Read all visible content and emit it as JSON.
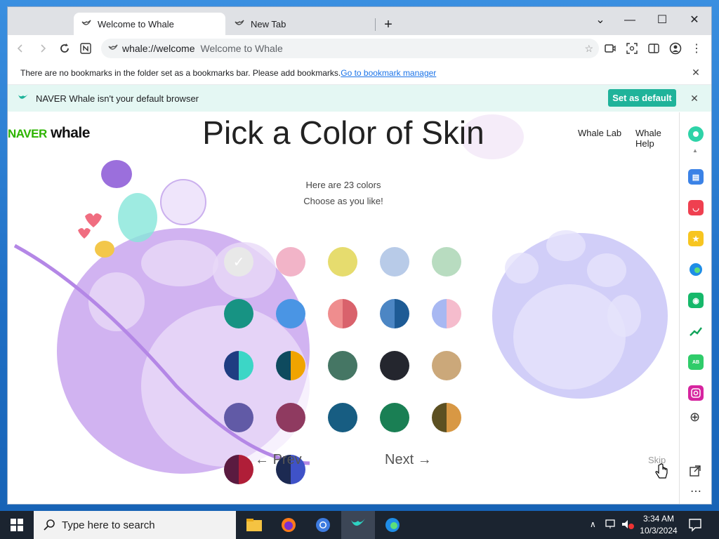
{
  "browser": {
    "tabs": [
      {
        "label": "Welcome to Whale",
        "active": true
      },
      {
        "label": "New Tab",
        "active": false
      }
    ],
    "window_controls": {
      "minimize": "—",
      "maximize": "☐",
      "close": "✕"
    },
    "address": {
      "url": "whale://welcome",
      "title": "Welcome to Whale"
    }
  },
  "bookmark_bar": {
    "message": "There are no bookmarks in the folder set as a bookmarks bar. Please add bookmarks.",
    "link": "Go to bookmark manager"
  },
  "default_bar": {
    "message": "NAVER Whale isn't your default browser",
    "button": "Set as default"
  },
  "page": {
    "logo_naver": "NAVER",
    "logo_whale": "whale",
    "heading": "Pick a Color of Skin",
    "nav_links": [
      "Whale Lab",
      "Whale Help"
    ],
    "subtitle_line1": "Here are 23 colors",
    "subtitle_line2": "Choose as you like!",
    "prev": "Prev",
    "next": "Next",
    "skip": "Skip",
    "swatches": [
      {
        "colors": [
          "#e8e8e8",
          "#e8e8e8"
        ],
        "selected": true
      },
      {
        "colors": [
          "#f2b4c8",
          "#f2b4c8"
        ]
      },
      {
        "colors": [
          "#e6dc6e",
          "#e6dc6e"
        ]
      },
      {
        "colors": [
          "#b8cbe8",
          "#b8cbe8"
        ]
      },
      {
        "colors": [
          "#b8dcc0",
          "#b8dcc0"
        ]
      },
      {
        "colors": [
          "#179383",
          "#179383"
        ]
      },
      {
        "colors": [
          "#4a95e4",
          "#4a95e4"
        ]
      },
      {
        "colors": [
          "#ef8d8e",
          "#d9626c"
        ]
      },
      {
        "colors": [
          "#4c86c4",
          "#1e5b95"
        ]
      },
      {
        "colors": [
          "#a8b8f2",
          "#f5bccd"
        ]
      },
      {
        "colors": [
          "#1f3d82",
          "#3cd6c6"
        ]
      },
      {
        "colors": [
          "#0e4a5e",
          "#f0a400"
        ]
      },
      {
        "colors": [
          "#457664",
          "#457664"
        ]
      },
      {
        "colors": [
          "#24262e",
          "#24262e"
        ]
      },
      {
        "colors": [
          "#cba87a",
          "#cba87a"
        ]
      },
      {
        "colors": [
          "#615aa6",
          "#615aa6"
        ]
      },
      {
        "colors": [
          "#8f3a60",
          "#8f3a60"
        ]
      },
      {
        "colors": [
          "#175d82",
          "#175d82"
        ]
      },
      {
        "colors": [
          "#1a7f54",
          "#1a7f54"
        ]
      },
      {
        "colors": [
          "#5c5022",
          "#d89844"
        ]
      },
      {
        "colors": [
          "#5a1b40",
          "#b01e38"
        ]
      },
      {
        "colors": [
          "#1c2a52",
          "#3f52c8"
        ]
      }
    ]
  },
  "sidebar": {
    "icons": [
      "whale-circle-icon",
      "calendar-icon",
      "pocket-icon",
      "star-icon",
      "edge-icon",
      "robot-icon",
      "finance-icon",
      "papago-icon",
      "instagram-icon",
      "add-icon",
      "external-link-icon",
      "more-icon"
    ]
  },
  "taskbar": {
    "search_placeholder": "Type here to search",
    "time": "3:34 AM",
    "date": "10/3/2024"
  }
}
